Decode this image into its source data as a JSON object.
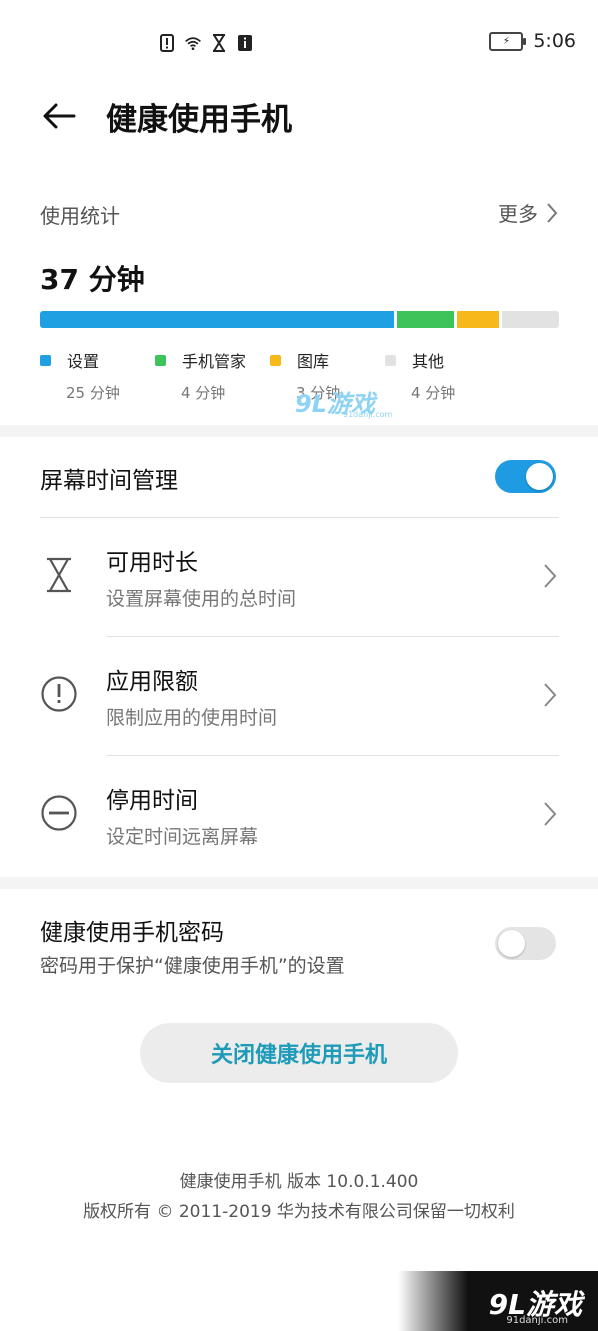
{
  "status_bar": {
    "time": "5:06",
    "left_icons": [
      "notification-icon",
      "wifi-icon",
      "hourglass-icon",
      "info-icon"
    ],
    "battery_icon": "battery-charging-icon"
  },
  "header": {
    "back_icon": "arrow-left-icon",
    "title": "健康使用手机"
  },
  "usage": {
    "label": "使用统计",
    "more_label": "更多",
    "total": "37 分钟",
    "bar_colors": [
      "#1ea0e2",
      "#3cc35a",
      "#f6b81b",
      "#e2e2e2"
    ],
    "apps": [
      {
        "name": "设置",
        "time": "25 分钟",
        "minutes": 25,
        "color": "#1ea0e2"
      },
      {
        "name": "手机管家",
        "time": "4 分钟",
        "minutes": 4,
        "color": "#3cc35a"
      },
      {
        "name": "图库",
        "time": "3 分钟",
        "minutes": 3,
        "color": "#f6b81b"
      },
      {
        "name": "其他",
        "time": "4 分钟",
        "minutes": 4,
        "color": "#e2e2e2"
      }
    ]
  },
  "screen_time": {
    "title": "屏幕时间管理",
    "enabled": true,
    "items": [
      {
        "icon": "hourglass-icon",
        "title": "可用时长",
        "subtitle": "设置屏幕使用的总时间"
      },
      {
        "icon": "exclamation-circle-icon",
        "title": "应用限额",
        "subtitle": "限制应用的使用时间"
      },
      {
        "icon": "minus-circle-icon",
        "title": "停用时间",
        "subtitle": "设定时间远离屏幕"
      }
    ]
  },
  "password": {
    "title": "健康使用手机密码",
    "subtitle": "密码用于保护“健康使用手机”的设置",
    "enabled": false
  },
  "close_button": "关闭健康使用手机",
  "footer": {
    "version": "健康使用手机 版本 10.0.1.400",
    "copyright": "版权所有 © 2011-2019 华为技术有限公司保留一切权利"
  },
  "watermarks": {
    "top_text": "9L游戏",
    "top_url": "91danji.com",
    "bottom_text": "9L游戏",
    "bottom_url": "91danji.com"
  },
  "colors": {
    "accent": "#1e9be3",
    "button_text": "#1e9bb8"
  }
}
